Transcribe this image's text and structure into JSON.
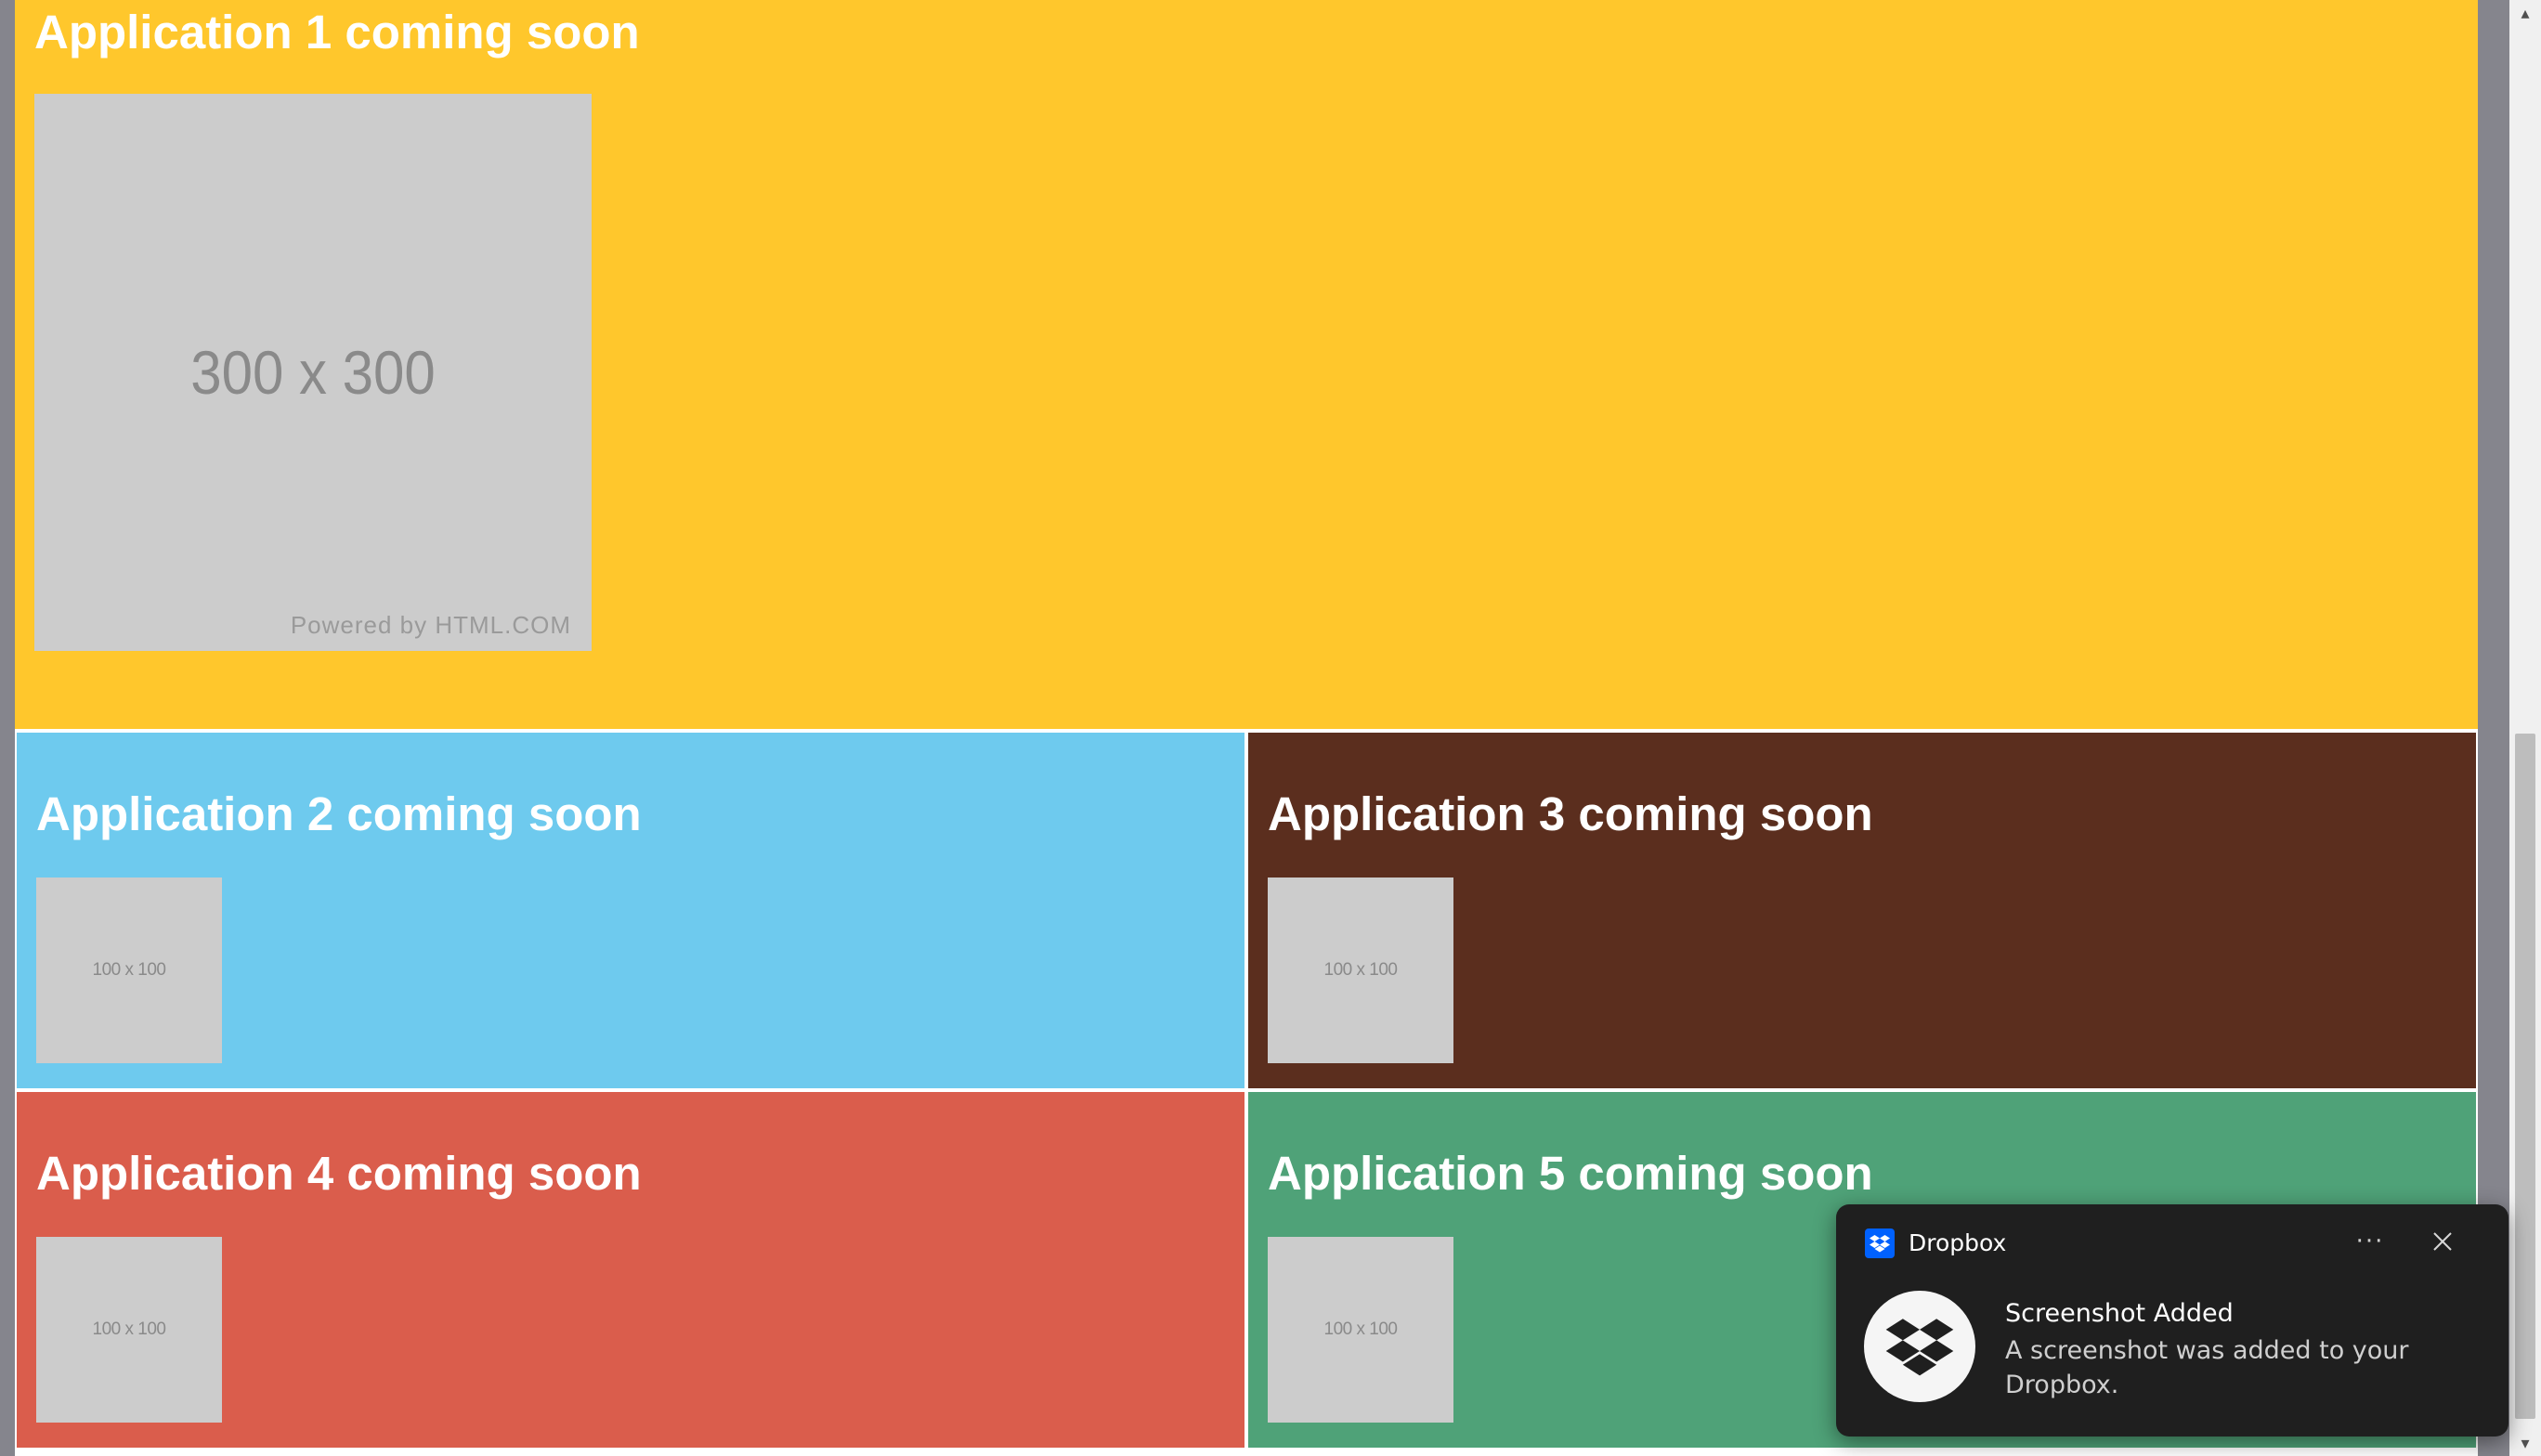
{
  "colors": {
    "app1": "#ffc72c",
    "app2": "#6ecaee",
    "app3": "#5b2e1e",
    "app4": "#da5d4c",
    "app5": "#4fa278",
    "placeholder": "#cccccc",
    "toast_bg": "#1f1f1f",
    "dropbox_blue": "#0061fe"
  },
  "panels": [
    {
      "title": "Application 1 coming soon",
      "image_label": "300 x 300",
      "image_credit": "Powered by HTML.COM"
    },
    {
      "title": "Application 2 coming soon",
      "image_label": "100 x 100"
    },
    {
      "title": "Application 3 coming soon",
      "image_label": "100 x 100"
    },
    {
      "title": "Application 4 coming soon",
      "image_label": "100 x 100"
    },
    {
      "title": "Application 5 coming soon",
      "image_label": "100 x 100"
    }
  ],
  "notification": {
    "app_name": "Dropbox",
    "app_icon": "dropbox-icon",
    "more_label": "···",
    "title": "Screenshot Added",
    "body": "A screenshot was added to your Dropbox."
  }
}
